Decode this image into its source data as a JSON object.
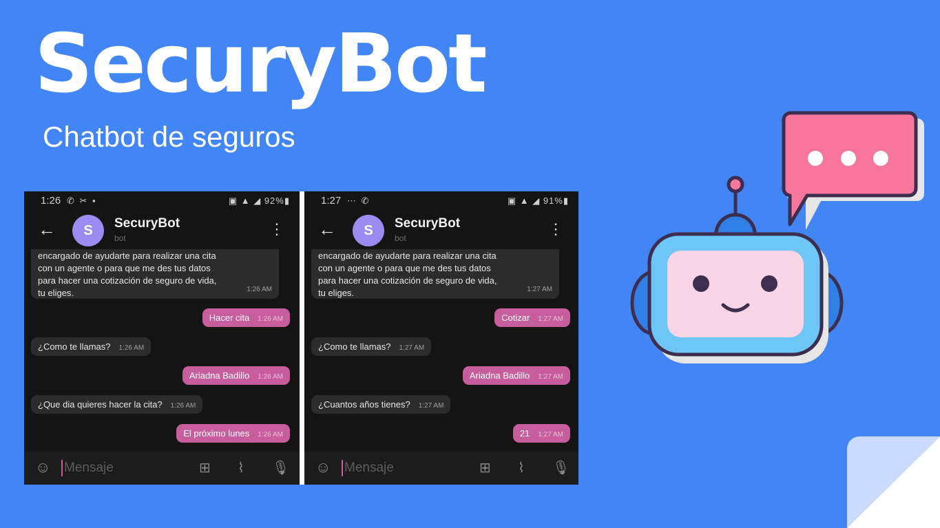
{
  "slide": {
    "title": "SecuryBot",
    "subtitle": "Chatbot de seguros"
  },
  "phones": [
    {
      "status": {
        "time": "1:26",
        "battery": "92%"
      },
      "chat": {
        "name": "SecuryBot",
        "sub": "bot",
        "avatar": "S"
      },
      "first_message": {
        "lines": [
          "encargado de ayudarte para realizar una cita",
          "con un agente o para que me des tus datos",
          "para hacer una cotización de seguro de vida,",
          "tu eliges."
        ],
        "time": "1:26 AM"
      },
      "messages": [
        {
          "text": "Hacer cita",
          "time": "1:26 AM",
          "dir": "out"
        },
        {
          "text": "¿Como te llamas?",
          "time": "1:26 AM",
          "dir": "in"
        },
        {
          "text": "Ariadna Badillo",
          "time": "1:26 AM",
          "dir": "out"
        },
        {
          "text": "¿Que dia quieres hacer la cita?",
          "time": "1:26 AM",
          "dir": "in"
        },
        {
          "text": "El próximo lunes",
          "time": "1:26 AM",
          "dir": "out"
        }
      ],
      "input_placeholder": "Mensaje"
    },
    {
      "status": {
        "time": "1:27",
        "battery": "91%"
      },
      "chat": {
        "name": "SecuryBot",
        "sub": "bot",
        "avatar": "S"
      },
      "first_message": {
        "lines": [
          "encargado de ayudarte para realizar una cita",
          "con un agente o para que me des tus datos",
          "para hacer una cotización de seguro de vida,",
          "tu eliges."
        ],
        "time": "1:27 AM"
      },
      "messages": [
        {
          "text": "Cotizar",
          "time": "1:27 AM",
          "dir": "out"
        },
        {
          "text": "¿Como te llamas?",
          "time": "1:27 AM",
          "dir": "in"
        },
        {
          "text": "Ariadna Badillo",
          "time": "1:27 AM",
          "dir": "out"
        },
        {
          "text": "¿Cuantos años tienes?",
          "time": "1:27 AM",
          "dir": "in"
        },
        {
          "text": "21",
          "time": "1:27 AM",
          "dir": "out"
        }
      ],
      "input_placeholder": "Mensaje"
    }
  ],
  "icons": {
    "back": "back-arrow-icon",
    "menu": "kebab-menu-icon",
    "emoji": "sticker-icon",
    "bot_commands": "bot-commands-icon",
    "attach": "paperclip-icon",
    "mic": "microphone-icon",
    "illustration": "robot-chat-icon"
  },
  "colors": {
    "background": "#4285f4",
    "outgoing_bubble": "#c75d9d",
    "incoming_bubble": "#2c2c2c",
    "avatar": "#9c8cf2",
    "robot_speech_bubble": "#f7769c",
    "robot_face": "#f9d5e5",
    "robot_frame": "#6ec6f7"
  }
}
